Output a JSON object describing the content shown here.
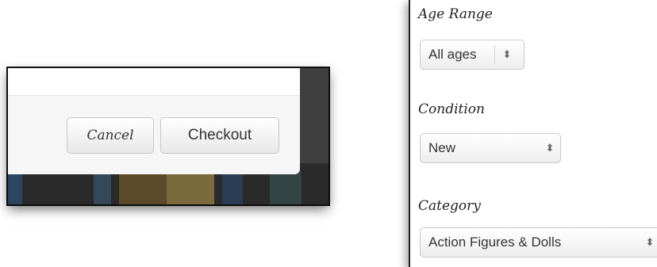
{
  "checkout_dialog": {
    "cancel_label": "Cancel",
    "checkout_label": "Checkout"
  },
  "filters": {
    "age_range": {
      "label": "Age Range",
      "value": "All ages"
    },
    "condition": {
      "label": "Condition",
      "value": "New"
    },
    "category": {
      "label": "Category",
      "value": "Action Figures & Dolls"
    },
    "select_arrow_glyph": "⬍"
  },
  "colors": {
    "modal_background": "#ffffff",
    "backdrop": "#3f3f3f",
    "button_border": "#c7c7c7"
  }
}
